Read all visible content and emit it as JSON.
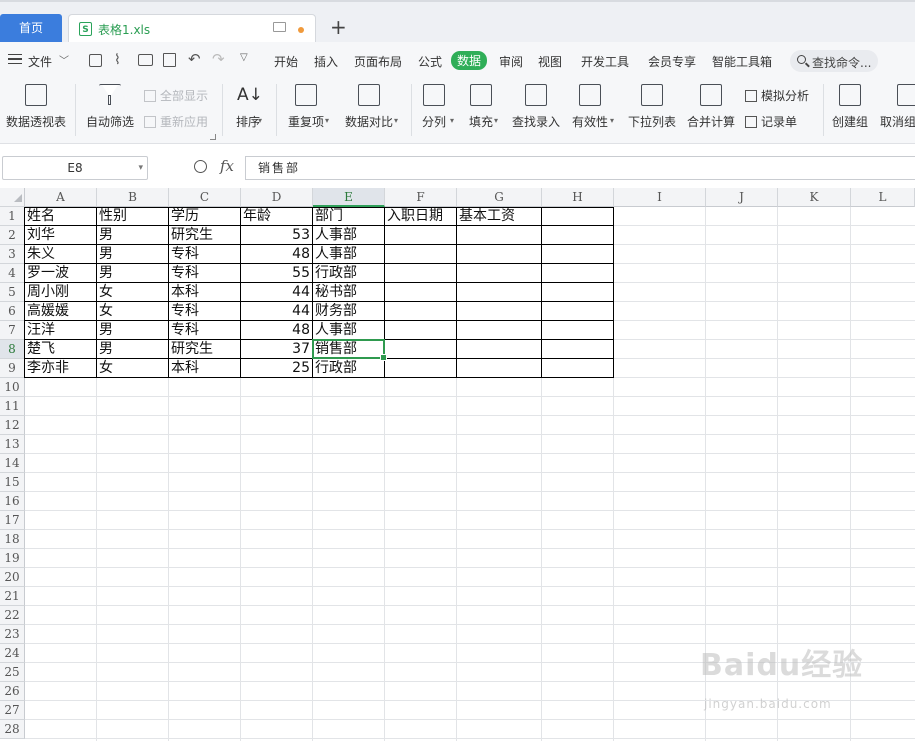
{
  "tabs": {
    "home": "首页",
    "file": "表格1.xls",
    "new_tab": "+"
  },
  "menu": {
    "file": "文件",
    "items": [
      "开始",
      "插入",
      "页面布局",
      "公式",
      "数据",
      "审阅",
      "视图",
      "开发工具",
      "会员专享",
      "智能工具箱"
    ],
    "active": "数据",
    "search": "查找命令..."
  },
  "ribbon": {
    "pivot": "数据透视表",
    "autofilter": "自动筛选",
    "show_all": "全部显示",
    "reapply": "重新应用",
    "sort": "排序",
    "duplicates": "重复项",
    "compare": "数据对比",
    "split": "分列",
    "fill": "填充",
    "lookup": "查找录入",
    "validity": "有效性",
    "dropdown": "下拉列表",
    "consolidate": "合并计算",
    "whatif": "模拟分析",
    "record": "记录单",
    "group": "创建组",
    "ungroup": "取消组"
  },
  "formula_bar": {
    "name_box": "E8",
    "fx": "fx",
    "value": "销售部"
  },
  "sheet": {
    "columns": [
      "A",
      "B",
      "C",
      "D",
      "E",
      "F",
      "G",
      "H",
      "I",
      "J",
      "K",
      "L"
    ],
    "rows": [
      "1",
      "2",
      "3",
      "4",
      "5",
      "6",
      "7",
      "8",
      "9",
      "10",
      "11",
      "12",
      "13",
      "14",
      "15",
      "16",
      "17",
      "18",
      "19",
      "20",
      "21",
      "22",
      "23",
      "24",
      "25",
      "26",
      "27",
      "28"
    ],
    "selected_cell": "E8",
    "header": [
      "姓名",
      "性别",
      "学历",
      "年龄",
      "部门",
      "入职日期",
      "基本工资"
    ],
    "data": [
      [
        "刘华",
        "男",
        "研究生",
        "53",
        "人事部"
      ],
      [
        "朱义",
        "男",
        "专科",
        "48",
        "人事部"
      ],
      [
        "罗一波",
        "男",
        "专科",
        "55",
        "行政部"
      ],
      [
        "周小刚",
        "女",
        "本科",
        "44",
        "秘书部"
      ],
      [
        "高媛媛",
        "女",
        "专科",
        "44",
        "财务部"
      ],
      [
        "汪洋",
        "男",
        "专科",
        "48",
        "人事部"
      ],
      [
        "楚飞",
        "男",
        "研究生",
        "37",
        "销售部"
      ],
      [
        "李亦非",
        "女",
        "本科",
        "25",
        "行政部"
      ]
    ]
  },
  "watermark": {
    "main": "Baidu经验",
    "sub": "jingyan.baidu.com"
  }
}
